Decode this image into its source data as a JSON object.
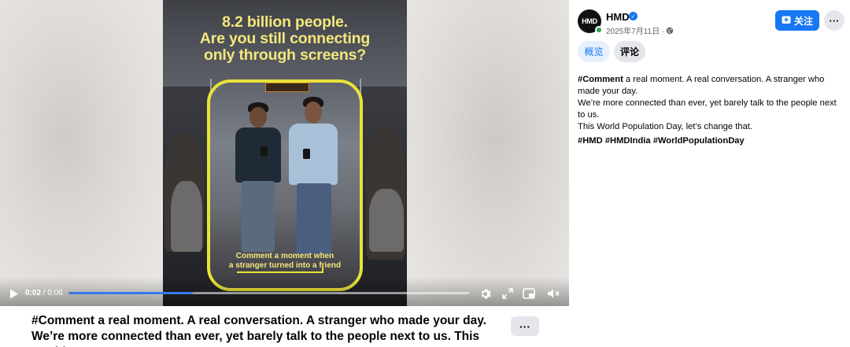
{
  "video": {
    "poster_title_line1": "8.2 billion people.",
    "poster_title_line2": "Are you still connecting",
    "poster_title_line3": "only through screens?",
    "poster_caption_line1": "Comment a moment when",
    "poster_caption_line2": "a stranger turned into a friend",
    "time_current": "0:02",
    "time_separator": " / ",
    "time_total": "0:06",
    "progress_fraction": 0.31,
    "accent_color": "#3b78e7",
    "poster_accent_color": "#e9e23a"
  },
  "caption": {
    "text": "#Comment a real moment. A real conversation. A stranger who made your day. We’re more connected than ever, yet barely talk to the people next to us. This World...",
    "more_label": "···"
  },
  "post": {
    "avatar_text": "HMD",
    "page_name": "HMD",
    "verified_icon": "verified-badge-icon",
    "date": "2025年7月11日 ·",
    "follow_label": "关注",
    "more_label": "···",
    "tabs": [
      {
        "label": "概览",
        "active": true
      },
      {
        "label": "评论",
        "active": false
      }
    ],
    "body_hashtag": "#Comment",
    "body_line1_rest": " a real moment. A real conversation. A stranger who made your day.",
    "body_line2": "We’re more connected than ever, yet barely talk to the people next to us.",
    "body_line3": "This World Population Day, let’s change that.",
    "tags": "#HMD #HMDIndia #WorldPopulationDay",
    "brand_color": "#1877f2"
  }
}
